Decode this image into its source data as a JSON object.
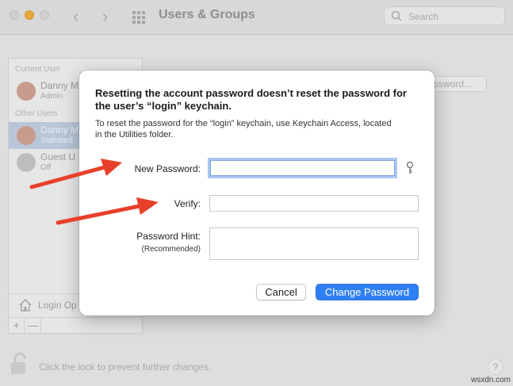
{
  "window": {
    "title": "Users & Groups",
    "search_placeholder": "Search"
  },
  "sidebar": {
    "current_user_header": "Current User",
    "other_users_header": "Other Users",
    "users": [
      {
        "name": "Danny M",
        "role": "Admin"
      },
      {
        "name": "Danny M",
        "role": "Standard"
      },
      {
        "name": "Guest U",
        "role": "Off"
      }
    ],
    "login_options": "Login Op",
    "add_label": "+",
    "remove_label": "—"
  },
  "background": {
    "password_button": "ssword...",
    "lock_text": "Click the lock to prevent further changes.",
    "help_label": "?"
  },
  "dialog": {
    "title": "Resetting the account password doesn’t reset the password for the user’s “login” keychain.",
    "subtitle": "To reset the password for the “login” keychain, use Keychain Access, located in the Utilities folder.",
    "new_password_label": "New Password:",
    "new_password_value": "",
    "verify_label": "Verify:",
    "verify_value": "",
    "hint_label": "Password Hint:",
    "hint_sublabel": "(Recommended)",
    "hint_value": "",
    "cancel_label": "Cancel",
    "change_label": "Change Password"
  },
  "colors": {
    "accent": "#2e7ff1",
    "arrow": "#e8402a",
    "focus_ring": "#a9c6ef"
  },
  "watermark": "wsxdn.com"
}
